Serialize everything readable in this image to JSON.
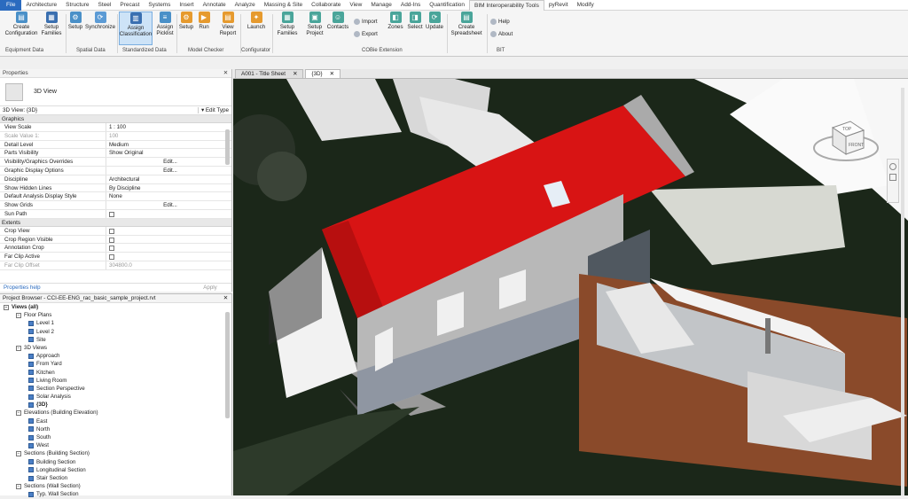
{
  "menu_tabs": [
    "File",
    "Architecture",
    "Structure",
    "Steel",
    "Precast",
    "Systems",
    "Insert",
    "Annotate",
    "Analyze",
    "Massing & Site",
    "Collaborate",
    "View",
    "Manage",
    "Add-Ins",
    "Quantification",
    "BIM Interoperability Tools",
    "pyRevit",
    "Modify"
  ],
  "ribbon": {
    "create_config": "Create Configuration",
    "setup_families": "Setup Families",
    "setup": "Setup",
    "synchronize": "Synchronize",
    "assign_classification": "Assign Classification",
    "assign_picklist": "Assign Picklist",
    "setup2": "Setup",
    "run": "Run",
    "view_report": "View Report",
    "launch": "Launch",
    "setup_families2": "Setup Families",
    "setup_project": "Setup Project",
    "contacts": "Contacts",
    "import": "Import",
    "export": "Export",
    "zones": "Zones",
    "select": "Select",
    "update": "Update",
    "create_spreadsheet": "Create Spreadsheet",
    "help": "Help",
    "about": "About",
    "groups": {
      "equipment": "Equipment Data",
      "spatial": "Spatial Data",
      "standardized": "Standardized Data",
      "model_checker": "Model Checker",
      "configurator": "Configurator",
      "cobie": "COBie Extension",
      "bit": "BIT"
    }
  },
  "properties": {
    "title": "Properties",
    "type_name": "3D View",
    "selector": "3D View: {3D}",
    "edit_type": "Edit Type",
    "groups": {
      "graphics": "Graphics",
      "extents": "Extents"
    },
    "graphics_rows": [
      {
        "k": "View Scale",
        "v": "1 : 100",
        "dim": false
      },
      {
        "k": "Scale Value   1:",
        "v": "100",
        "dim": true
      },
      {
        "k": "Detail Level",
        "v": "Medium",
        "dim": false
      },
      {
        "k": "Parts Visibility",
        "v": "Show Original",
        "dim": false
      },
      {
        "k": "Visibility/Graphics Overrides",
        "v": "Edit...",
        "dim": false,
        "btn": true
      },
      {
        "k": "Graphic Display Options",
        "v": "Edit...",
        "dim": false,
        "btn": true
      },
      {
        "k": "Discipline",
        "v": "Architectural",
        "dim": false
      },
      {
        "k": "Show Hidden Lines",
        "v": "By Discipline",
        "dim": false
      },
      {
        "k": "Default Analysis Display Style",
        "v": "None",
        "dim": false
      },
      {
        "k": "Show Grids",
        "v": "Edit...",
        "dim": false,
        "btn": true
      },
      {
        "k": "Sun Path",
        "v": "",
        "dim": false,
        "check": true
      }
    ],
    "extents_rows": [
      {
        "k": "Crop View",
        "v": "",
        "check": true
      },
      {
        "k": "Crop Region Visible",
        "v": "",
        "check": true
      },
      {
        "k": "Annotation Crop",
        "v": "",
        "check": true
      },
      {
        "k": "Far Clip Active",
        "v": "",
        "check": true
      },
      {
        "k": "Far Clip Offset",
        "v": "304800.0",
        "dim": true
      }
    ],
    "help_link": "Properties help",
    "apply": "Apply"
  },
  "browser": {
    "title": "Project Browser - CCI-EE-ENG_rac_basic_sample_project.rvt",
    "items": [
      {
        "t": "Views (all)",
        "lvl": 0,
        "kind": "toggle",
        "bold": true
      },
      {
        "t": "Floor Plans",
        "lvl": 1,
        "kind": "toggle"
      },
      {
        "t": "Level 1",
        "lvl": 2,
        "kind": "view"
      },
      {
        "t": "Level 2",
        "lvl": 2,
        "kind": "view"
      },
      {
        "t": "Site",
        "lvl": 2,
        "kind": "view"
      },
      {
        "t": "3D Views",
        "lvl": 1,
        "kind": "toggle"
      },
      {
        "t": "Approach",
        "lvl": 2,
        "kind": "view"
      },
      {
        "t": "From Yard",
        "lvl": 2,
        "kind": "view"
      },
      {
        "t": "Kitchen",
        "lvl": 2,
        "kind": "view"
      },
      {
        "t": "Living Room",
        "lvl": 2,
        "kind": "view"
      },
      {
        "t": "Section Perspective",
        "lvl": 2,
        "kind": "view"
      },
      {
        "t": "Solar Analysis",
        "lvl": 2,
        "kind": "view"
      },
      {
        "t": "{3D}",
        "lvl": 2,
        "kind": "view",
        "bold": true
      },
      {
        "t": "Elevations (Building Elevation)",
        "lvl": 1,
        "kind": "toggle"
      },
      {
        "t": "East",
        "lvl": 2,
        "kind": "view"
      },
      {
        "t": "North",
        "lvl": 2,
        "kind": "view"
      },
      {
        "t": "South",
        "lvl": 2,
        "kind": "view"
      },
      {
        "t": "West",
        "lvl": 2,
        "kind": "view"
      },
      {
        "t": "Sections (Building Section)",
        "lvl": 1,
        "kind": "toggle"
      },
      {
        "t": "Building Section",
        "lvl": 2,
        "kind": "view"
      },
      {
        "t": "Longitudinal Section",
        "lvl": 2,
        "kind": "view"
      },
      {
        "t": "Stair Section",
        "lvl": 2,
        "kind": "view"
      },
      {
        "t": "Sections (Wall Section)",
        "lvl": 1,
        "kind": "toggle"
      },
      {
        "t": "Typ. Wall Section",
        "lvl": 2,
        "kind": "view"
      }
    ]
  },
  "view_tabs": [
    {
      "label": "A001 - Title Sheet",
      "active": false
    },
    {
      "label": "{3D}",
      "active": true
    }
  ],
  "viewcube": {
    "top": "TOP",
    "front": "FRONT"
  }
}
